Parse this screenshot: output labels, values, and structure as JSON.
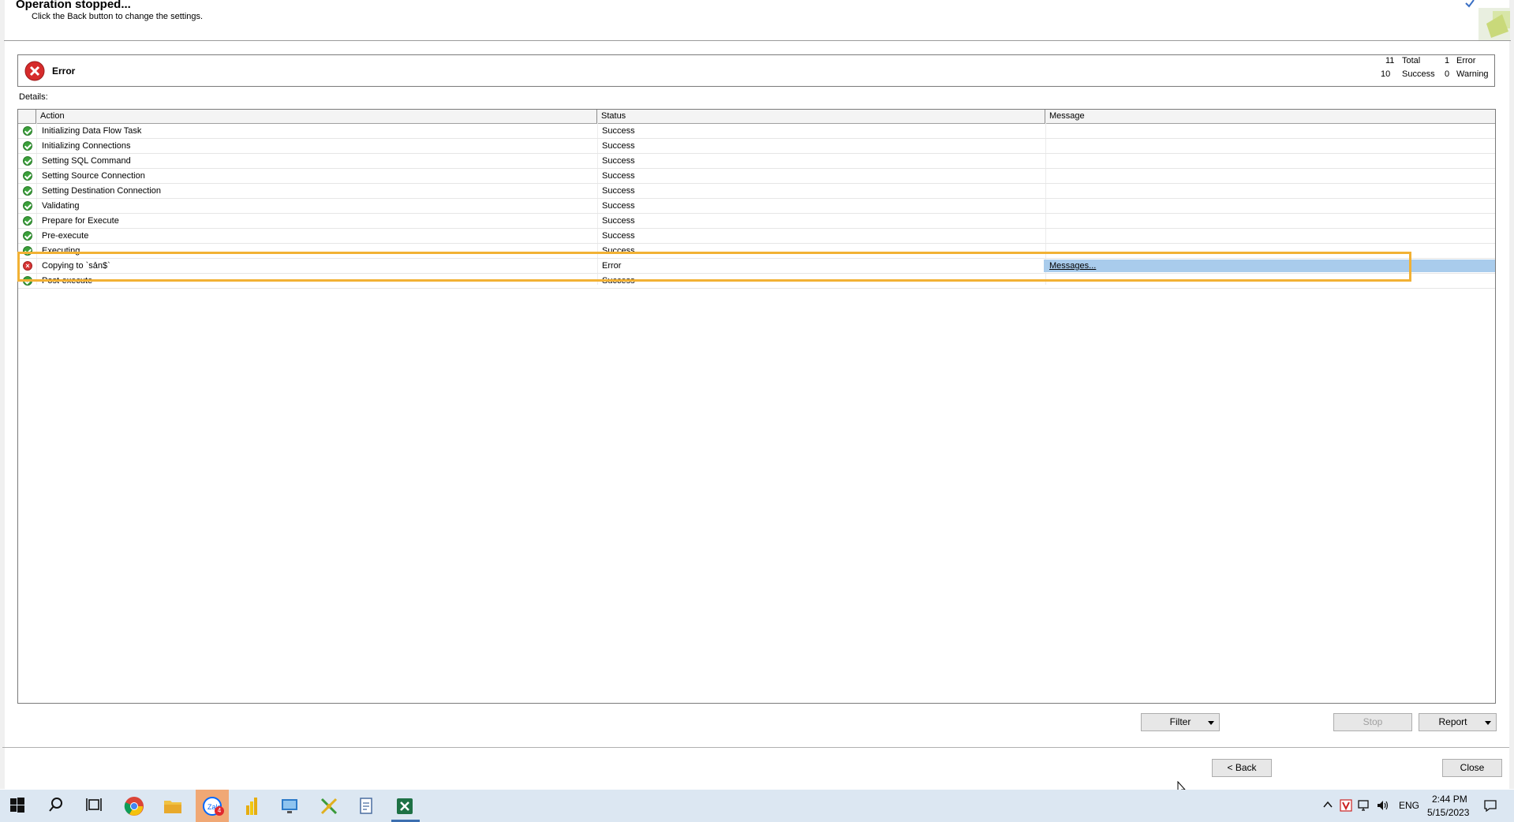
{
  "header": {
    "title": "Operation stopped...",
    "subtitle": "Click the Back button to change the settings."
  },
  "summary": {
    "status_label": "Error",
    "total_count": "11",
    "total_label": "Total",
    "success_count": "10",
    "success_label": "Success",
    "error_count": "1",
    "error_label": "Error",
    "warning_count": "0",
    "warning_label": "Warning"
  },
  "details_label": "Details:",
  "grid": {
    "columns": [
      "Action",
      "Status",
      "Message"
    ],
    "rows": [
      {
        "action": "Initializing Data Flow Task",
        "status": "Success",
        "message": "",
        "state": "ok"
      },
      {
        "action": "Initializing Connections",
        "status": "Success",
        "message": "",
        "state": "ok"
      },
      {
        "action": "Setting SQL Command",
        "status": "Success",
        "message": "",
        "state": "ok"
      },
      {
        "action": "Setting Source Connection",
        "status": "Success",
        "message": "",
        "state": "ok"
      },
      {
        "action": "Setting Destination Connection",
        "status": "Success",
        "message": "",
        "state": "ok"
      },
      {
        "action": "Validating",
        "status": "Success",
        "message": "",
        "state": "ok"
      },
      {
        "action": "Prepare for Execute",
        "status": "Success",
        "message": "",
        "state": "ok"
      },
      {
        "action": "Pre-execute",
        "status": "Success",
        "message": "",
        "state": "ok"
      },
      {
        "action": "Executing",
        "status": "Success",
        "message": "",
        "state": "ok"
      },
      {
        "action": "Copying to `sản$`",
        "status": "Error",
        "message": "Messages...",
        "state": "error"
      },
      {
        "action": "Post-execute",
        "status": "Success",
        "message": "",
        "state": "ok"
      }
    ]
  },
  "buttons": {
    "filter": "Filter",
    "stop": "Stop",
    "report": "Report",
    "back": "< Back",
    "close": "Close"
  },
  "taskbar": {
    "language": "ENG",
    "time": "2:44 PM",
    "date": "5/15/2023",
    "badge_count": "4"
  },
  "colors": {
    "highlight": "#f2b134",
    "selection": "#a9ccec",
    "success_icon": "#3aa03a",
    "error_icon": "#d93636"
  }
}
